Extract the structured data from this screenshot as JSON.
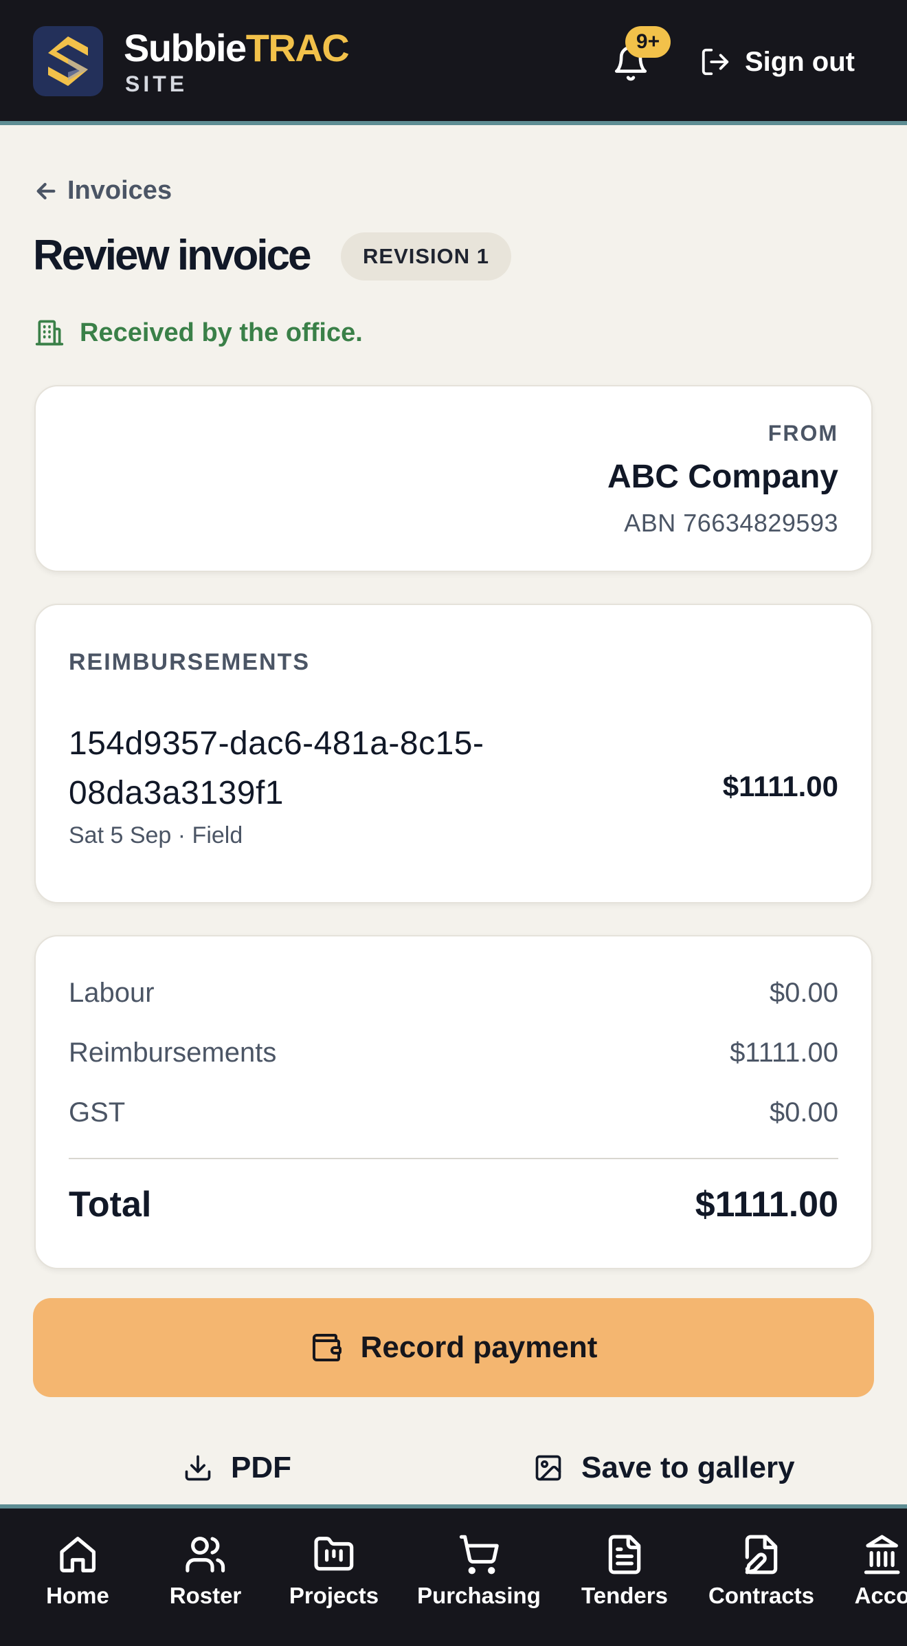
{
  "header": {
    "brand_primary": "Subbie",
    "brand_accent": "TRAC",
    "brand_sub": "SITE",
    "notification_count": "9+",
    "sign_out_label": "Sign out"
  },
  "breadcrumb": {
    "back_label": "Invoices"
  },
  "page": {
    "title": "Review invoice",
    "revision_badge": "REVISION 1",
    "status_text": "Received by the office."
  },
  "from_card": {
    "label": "FROM",
    "company": "ABC Company",
    "abn": "ABN 76634829593"
  },
  "reimbursements": {
    "heading": "REIMBURSEMENTS",
    "items": [
      {
        "id_line1": "154d9357-dac6-481a-8c15-",
        "id_line2": "08da3a3139f1",
        "meta": "Sat 5 Sep · Field",
        "amount": "$1111.00"
      }
    ]
  },
  "totals": {
    "rows": [
      {
        "label": "Labour",
        "value": "$0.00"
      },
      {
        "label": "Reimbursements",
        "value": "$1111.00"
      },
      {
        "label": "GST",
        "value": "$0.00"
      }
    ],
    "total_label": "Total",
    "total_value": "$1111.00"
  },
  "actions": {
    "record_payment": "Record payment",
    "pdf": "PDF",
    "save_gallery": "Save to gallery"
  },
  "bottom_nav": {
    "items": [
      {
        "label": "Home",
        "icon": "home-icon"
      },
      {
        "label": "Roster",
        "icon": "users-icon"
      },
      {
        "label": "Projects",
        "icon": "folder-icon"
      },
      {
        "label": "Purchasing",
        "icon": "cart-icon"
      },
      {
        "label": "Tenders",
        "icon": "document-icon"
      },
      {
        "label": "Contracts",
        "icon": "contract-edit-icon"
      },
      {
        "label": "Acco",
        "icon": "bank-icon"
      }
    ]
  },
  "colors": {
    "header_bg": "#16161c",
    "accent_yellow": "#f2c14a",
    "teal_border": "#5e8d93",
    "success_green": "#3a8048",
    "pay_button": "#f4b670",
    "page_bg": "#f4f2ec"
  }
}
